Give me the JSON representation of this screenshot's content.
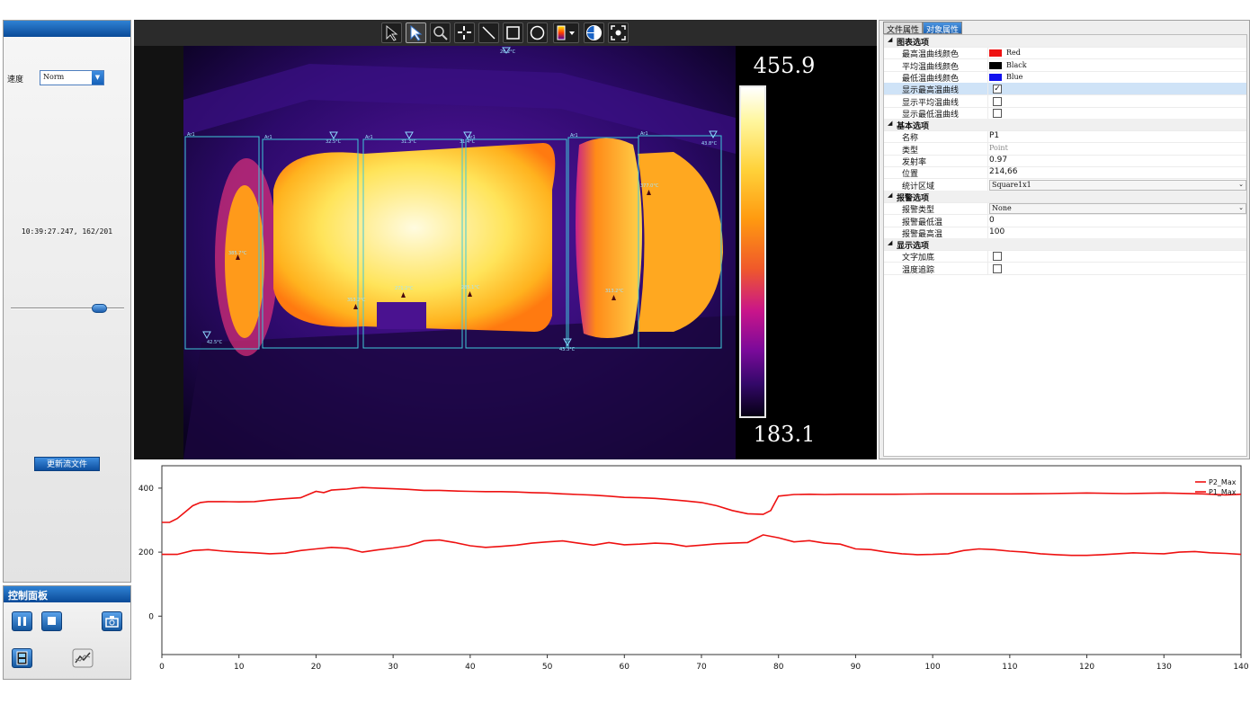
{
  "left_panel": {
    "speed_label": "速度",
    "speed_value": "Norm",
    "time_readout": "10:39:27.247, 162/201",
    "slider_position": 0.78,
    "update_button": "更新流文件"
  },
  "control_panel": {
    "title": "控制面板",
    "buttons": [
      "pause-icon",
      "stop-icon",
      "snapshot-icon",
      "film-icon",
      "trend-icon"
    ]
  },
  "viewer": {
    "toolbar_icons": [
      "arrow-select-icon",
      "pointer-select-icon",
      "zoom-icon",
      "pan-icon",
      "line-tool-icon",
      "rectangle-tool-icon",
      "ellipse-tool-icon",
      "palette-icon",
      "isotherm-icon",
      "fit-icon"
    ],
    "scale_max": "455.9",
    "scale_min": "183.1",
    "labels": {
      "top": "26.2°C",
      "a": "32.5°C",
      "b": "31.3°C",
      "c": "31.4°C",
      "d": "42.5°C",
      "e": "43.3°C",
      "f": "43.8°C",
      "p1": "385.7°C",
      "p2": "353.2°C",
      "p3": "271.2°C",
      "p4": "285.1°C",
      "p5": "313.2°C",
      "p6": "377.0°C",
      "ar": "Ar1"
    }
  },
  "properties": {
    "tab_file": "文件属性",
    "tab_object": "对象属性",
    "rows": [
      {
        "type": "category",
        "label": "图表选项"
      },
      {
        "type": "color",
        "label": "最高温曲线颜色",
        "value": "Red",
        "color": "#ee1111"
      },
      {
        "type": "color",
        "label": "平均温曲线颜色",
        "value": "Black",
        "color": "#000000"
      },
      {
        "type": "color",
        "label": "最低温曲线颜色",
        "value": "Blue",
        "color": "#1111ee"
      },
      {
        "type": "check",
        "label": "显示最高温曲线",
        "checked": true
      },
      {
        "type": "check",
        "label": "显示平均温曲线",
        "checked": false
      },
      {
        "type": "check",
        "label": "显示最低温曲线",
        "checked": false
      },
      {
        "type": "category",
        "label": "基本选项"
      },
      {
        "type": "text",
        "label": "名称",
        "value": "P1"
      },
      {
        "type": "muted",
        "label": "类型",
        "value": "Point"
      },
      {
        "type": "text",
        "label": "发射率",
        "value": "0.97"
      },
      {
        "type": "text",
        "label": "位置",
        "value": "214,66"
      },
      {
        "type": "dropdown",
        "label": "统计区域",
        "value": "Square1x1"
      },
      {
        "type": "category",
        "label": "报警选项"
      },
      {
        "type": "dropdown",
        "label": "报警类型",
        "value": "None"
      },
      {
        "type": "text",
        "label": "报警最低温",
        "value": "0"
      },
      {
        "type": "text",
        "label": "报警最高温",
        "value": "100"
      },
      {
        "type": "category",
        "label": "显示选项"
      },
      {
        "type": "check",
        "label": "文字加底",
        "checked": false
      },
      {
        "type": "check",
        "label": "温度追踪",
        "checked": false
      }
    ]
  },
  "chart_data": {
    "type": "line",
    "xlim": [
      0,
      140
    ],
    "ylim": [
      -120,
      470
    ],
    "xticks": [
      0,
      10,
      20,
      30,
      40,
      50,
      60,
      70,
      80,
      90,
      100,
      110,
      120,
      130,
      140
    ],
    "yticks": [
      0,
      200,
      400
    ],
    "legend_position": "top-right",
    "grid": false,
    "series": [
      {
        "name": "P2_Max",
        "color": "#ee1111",
        "x": [
          0,
          1,
          2,
          3,
          4,
          5,
          6,
          8,
          10,
          12,
          14,
          16,
          18,
          19,
          20,
          21,
          22,
          24,
          25,
          26,
          28,
          30,
          32,
          34,
          36,
          38,
          40,
          42,
          44,
          46,
          48,
          50,
          52,
          54,
          56,
          58,
          60,
          62,
          64,
          66,
          68,
          70,
          72,
          74,
          76,
          78,
          79,
          80,
          82,
          84,
          86,
          88,
          90,
          95,
          100,
          105,
          110,
          115,
          120,
          125,
          130,
          135,
          138,
          140
        ],
        "y": [
          293,
          293,
          305,
          325,
          345,
          355,
          358,
          358,
          357,
          358,
          363,
          367,
          370,
          380,
          390,
          386,
          394,
          397,
          400,
          402,
          400,
          398,
          396,
          393,
          393,
          391,
          390,
          389,
          389,
          388,
          386,
          385,
          382,
          380,
          378,
          375,
          371,
          370,
          368,
          364,
          360,
          355,
          345,
          330,
          320,
          318,
          330,
          375,
          380,
          381,
          380,
          381,
          381,
          381,
          382,
          382,
          382,
          383,
          385,
          383,
          385,
          382,
          379,
          381
        ]
      },
      {
        "name": "P1_Max",
        "color": "#ee1111",
        "x": [
          0,
          2,
          4,
          6,
          8,
          10,
          12,
          14,
          16,
          18,
          20,
          22,
          24,
          26,
          28,
          30,
          32,
          34,
          36,
          38,
          40,
          42,
          44,
          46,
          48,
          50,
          52,
          54,
          56,
          58,
          60,
          62,
          64,
          66,
          68,
          70,
          72,
          74,
          76,
          78,
          80,
          82,
          84,
          86,
          88,
          90,
          92,
          94,
          96,
          98,
          100,
          102,
          104,
          106,
          108,
          110,
          112,
          114,
          116,
          118,
          120,
          122,
          124,
          126,
          128,
          130,
          132,
          134,
          136,
          138,
          140
        ],
        "y": [
          193,
          193,
          205,
          208,
          203,
          200,
          198,
          195,
          197,
          205,
          210,
          215,
          212,
          200,
          207,
          213,
          220,
          235,
          238,
          230,
          220,
          215,
          218,
          222,
          228,
          232,
          235,
          228,
          222,
          230,
          223,
          225,
          228,
          226,
          218,
          222,
          226,
          228,
          230,
          254,
          245,
          232,
          236,
          228,
          225,
          210,
          208,
          200,
          195,
          192,
          193,
          195,
          205,
          210,
          208,
          203,
          200,
          195,
          192,
          190,
          190,
          192,
          195,
          198,
          196,
          195,
          200,
          202,
          198,
          196,
          193
        ]
      }
    ]
  }
}
